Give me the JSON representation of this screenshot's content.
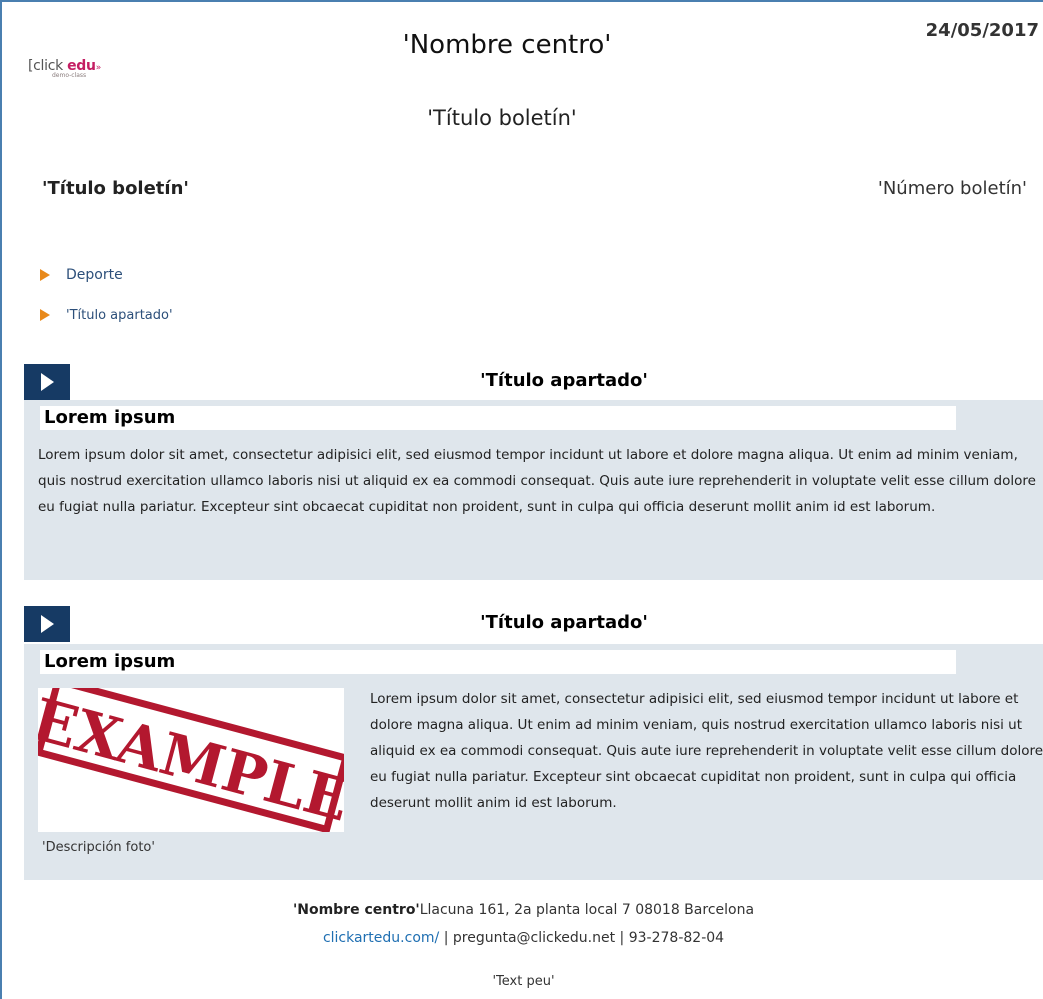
{
  "header": {
    "logo_text": "[click edu",
    "logo_brand": "edu",
    "logo_sub": "demo-class",
    "date": "24/05/2017",
    "center_name": "'Nombre centro'",
    "bulletin_title": "'Título boletín'"
  },
  "bulletin_bar": {
    "title": "'Título boletín'",
    "number": "'Número boletín'"
  },
  "toc": {
    "items": [
      {
        "label": "Deporte"
      },
      {
        "label": "'Título apartado'"
      }
    ]
  },
  "sections": [
    {
      "title": "'Título apartado'",
      "article_title": "Lorem ipsum",
      "body": "Lorem ipsum dolor sit amet, consectetur adipisici elit, sed eiusmod tempor incidunt ut labore et dolore magna aliqua. Ut enim ad minim veniam, quis nostrud exercitation ullamco laboris nisi ut aliquid ex ea commodi consequat. Quis aute iure reprehenderit in voluptate velit esse cillum dolore eu fugiat nulla pariatur. Excepteur sint obcaecat cupiditat non proident, sunt in culpa qui officia deserunt mollit anim id est laborum."
    },
    {
      "title": "'Título apartado'",
      "article_title": "Lorem ipsum",
      "image_text": "EXAMPLE",
      "caption": "'Descripción foto'",
      "body": "Lorem ipsum dolor sit amet, consectetur adipisici elit, sed eiusmod tempor incidunt ut labore et dolore magna aliqua. Ut enim ad minim veniam, quis nostrud exercitation ullamco laboris nisi ut aliquid ex ea commodi consequat. Quis aute iure reprehenderit in voluptate velit esse cillum dolore eu fugiat nulla pariatur. Excepteur sint obcaecat cupiditat non proident, sunt in culpa qui officia deserunt mollit anim id est laborum."
    }
  ],
  "footer": {
    "center_name": "'Nombre centro'",
    "address": "Llacuna 161, 2a planta local 7 08018 Barcelona",
    "website": "clickartedu.com/",
    "separator": " | ",
    "email": "pregunta@clickedu.net",
    "phone": "93-278-82-04",
    "text_peu": "'Text peu'"
  },
  "colors": {
    "accent_orange": "#e8891a",
    "navy": "#163a64",
    "panel_bg": "#dfe6ec",
    "brand_pink": "#c41e63",
    "link_blue": "#1f6fb2"
  }
}
